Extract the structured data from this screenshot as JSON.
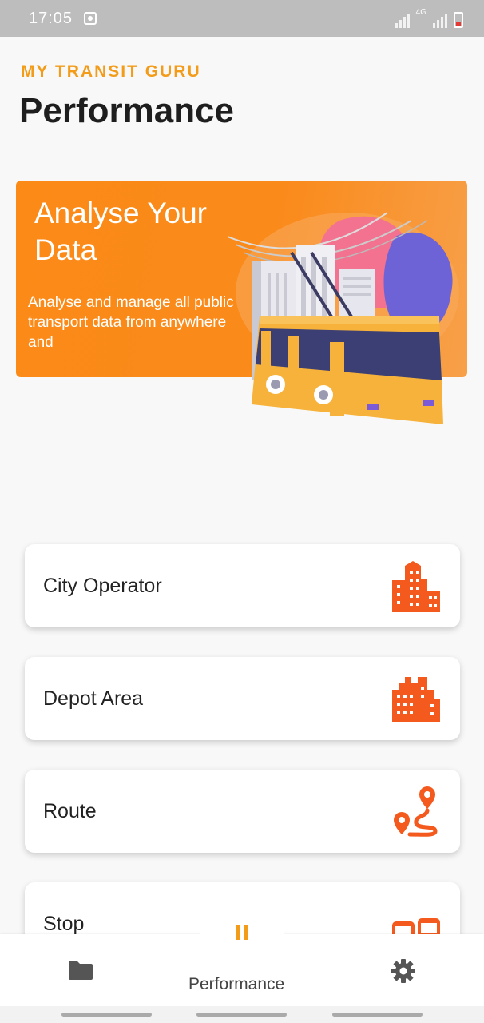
{
  "status_bar": {
    "time": "17:05",
    "network": "4G"
  },
  "header": {
    "brand": "MY TRANSIT GURU",
    "title": "Performance"
  },
  "banner": {
    "heading": "Analyse Your Data",
    "text": "Analyse and manage all public transport data from anywhere and"
  },
  "menu": [
    {
      "label": "City Operator",
      "icon": "city-buildings-icon"
    },
    {
      "label": "Depot Area",
      "icon": "depot-buildings-icon"
    },
    {
      "label": "Route",
      "icon": "route-map-icon"
    },
    {
      "label": "Stop",
      "icon": "bus-stop-icon"
    }
  ],
  "bottom_nav": {
    "active_label": "Performance",
    "items": [
      "folder-icon",
      "pause-icon",
      "settings-gear-icon"
    ]
  },
  "colors": {
    "accent": "#f39c1a",
    "icon": "#f45a1d",
    "banner": "#fb8a17"
  }
}
